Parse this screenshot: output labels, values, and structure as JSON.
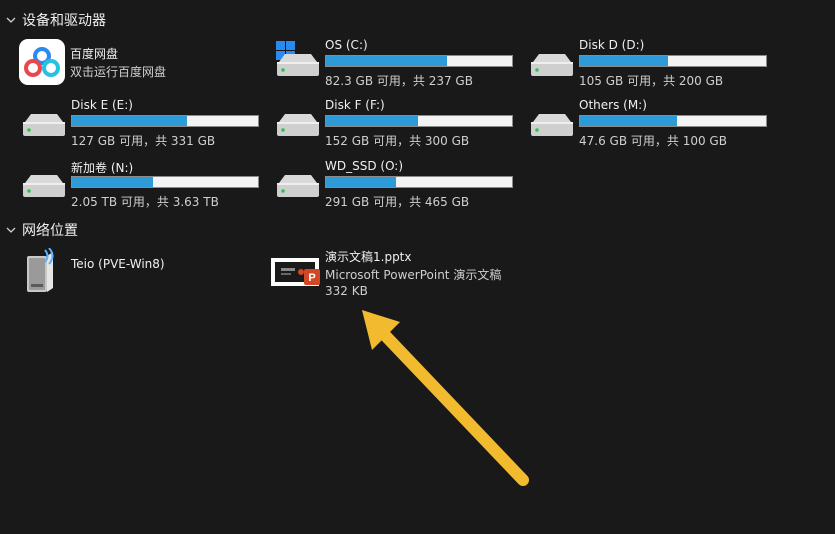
{
  "groups": {
    "devices": {
      "title": "设备和驱动器"
    },
    "network": {
      "title": "网络位置"
    }
  },
  "baidu": {
    "name": "百度网盘",
    "desc": "双击运行百度网盘",
    "icon": "baidu-netdisk-icon"
  },
  "drives": [
    {
      "name": "OS (C:)",
      "info": "82.3 GB 可用，共 237 GB",
      "used_fraction": 0.653,
      "icon": "windows-drive-icon"
    },
    {
      "name": "Disk D (D:)",
      "info": "105 GB 可用，共 200 GB",
      "used_fraction": 0.475,
      "icon": "hard-drive-icon"
    },
    {
      "name": "Disk E (E:)",
      "info": "127 GB 可用，共 331 GB",
      "used_fraction": 0.616,
      "icon": "hard-drive-icon"
    },
    {
      "name": "Disk F (F:)",
      "info": "152 GB 可用，共 300 GB",
      "used_fraction": 0.493,
      "icon": "hard-drive-icon"
    },
    {
      "name": "Others (M:)",
      "info": "47.6 GB 可用，共 100 GB",
      "used_fraction": 0.524,
      "icon": "hard-drive-icon"
    },
    {
      "name": "新加卷 (N:)",
      "info": "2.05 TB 可用，共 3.63 TB",
      "used_fraction": 0.435,
      "icon": "hard-drive-icon"
    },
    {
      "name": "WD_SSD (O:)",
      "info": "291 GB 可用，共 465 GB",
      "used_fraction": 0.374,
      "icon": "hard-drive-icon"
    }
  ],
  "network_items": [
    {
      "name": "Teio (PVE-Win8)",
      "icon": "network-drive-icon"
    }
  ],
  "file": {
    "name": "演示文稿1.pptx",
    "type": "Microsoft PowerPoint 演示文稿",
    "size": "332 KB",
    "icon": "pptx-thumbnail-icon"
  },
  "colors": {
    "background": "#191919",
    "bar_fill": "#2f9ad8",
    "arrow": "#f2bb2f"
  }
}
